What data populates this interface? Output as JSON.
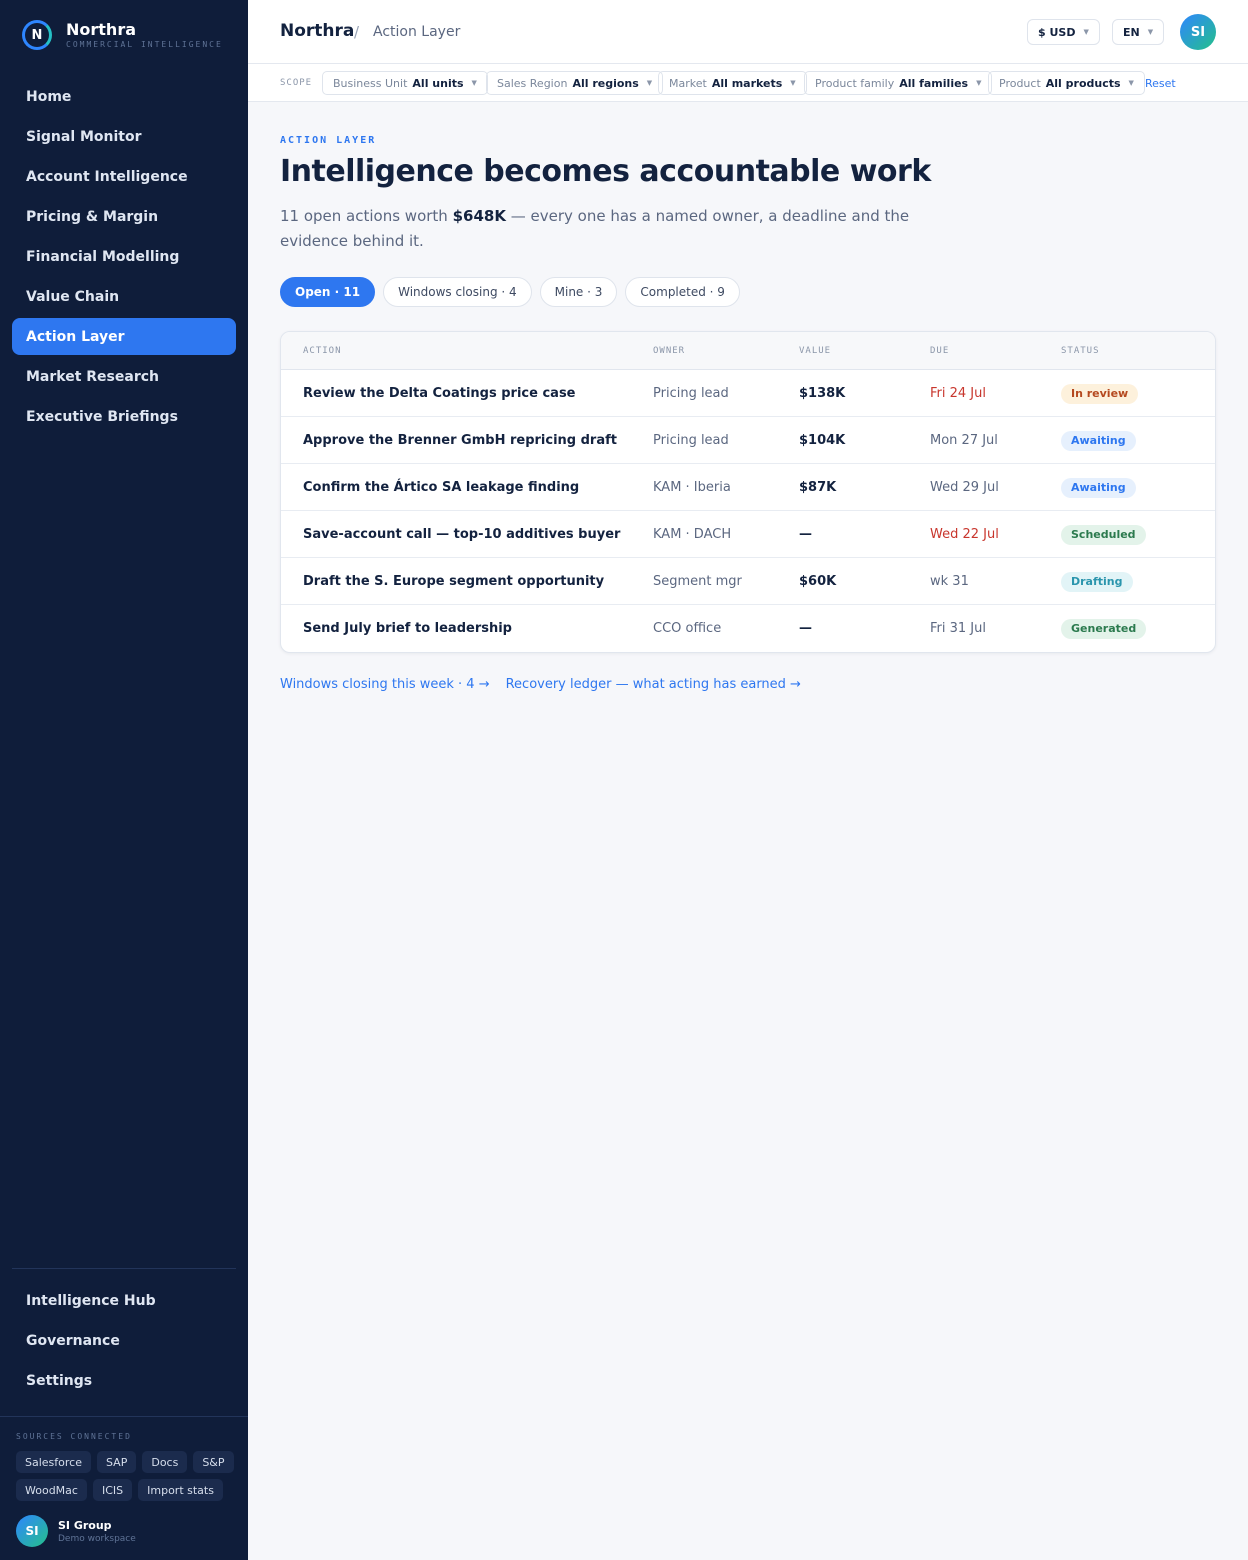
{
  "brand": {
    "name": "Northra",
    "tagline": "COMMERCIAL INTELLIGENCE",
    "logo_letter": "N"
  },
  "nav": [
    {
      "label": "Home"
    },
    {
      "label": "Signal Monitor"
    },
    {
      "label": "Account Intelligence"
    },
    {
      "label": "Pricing & Margin"
    },
    {
      "label": "Financial Modelling"
    },
    {
      "label": "Value Chain"
    },
    {
      "label": "Action Layer",
      "active": true
    },
    {
      "label": "Market Research"
    },
    {
      "label": "Executive Briefings"
    }
  ],
  "nav_bottom": [
    {
      "label": "Intelligence Hub"
    },
    {
      "label": "Governance"
    },
    {
      "label": "Settings"
    }
  ],
  "sources": {
    "label": "SOURCES CONNECTED",
    "items": [
      "Salesforce",
      "SAP",
      "Docs",
      "S&P",
      "WoodMac",
      "ICIS",
      "Import stats"
    ]
  },
  "workspace": {
    "initials": "SI",
    "name": "SI Group",
    "subtitle": "Demo workspace"
  },
  "topbar": {
    "app": "Northra",
    "separator": "/",
    "page": "Action Layer",
    "currency": "$ USD",
    "language": "EN",
    "user_initials": "SI"
  },
  "scope": {
    "label": "SCOPE",
    "filters": [
      {
        "label": "Business Unit",
        "value": "All units"
      },
      {
        "label": "Sales Region",
        "value": "All regions"
      },
      {
        "label": "Market",
        "value": "All markets"
      },
      {
        "label": "Product family",
        "value": "All families"
      },
      {
        "label": "Product",
        "value": "All products"
      }
    ],
    "reset": "Reset"
  },
  "main": {
    "eyebrow": "ACTION LAYER",
    "title": "Intelligence becomes accountable work",
    "lede_prefix": "11 open actions worth ",
    "lede_amount": "$648K",
    "lede_suffix": " — every one has a named owner, a deadline and the evidence behind it.",
    "tabs": [
      {
        "label": "Open · 11",
        "active": true
      },
      {
        "label": "Windows closing · 4"
      },
      {
        "label": "Mine · 3"
      },
      {
        "label": "Completed · 9"
      }
    ]
  },
  "table": {
    "columns": [
      "ACTION",
      "OWNER",
      "VALUE",
      "DUE",
      "STATUS"
    ],
    "rows": [
      {
        "action": "Review the Delta Coatings price case",
        "owner": "Pricing lead",
        "value": "$138K",
        "due": "Fri 24 Jul",
        "due_urgent": true,
        "status": "In review",
        "status_kind": "review"
      },
      {
        "action": "Approve the Brenner GmbH repricing draft",
        "owner": "Pricing lead",
        "value": "$104K",
        "due": "Mon 27 Jul",
        "due_urgent": false,
        "status": "Awaiting",
        "status_kind": "awaiting"
      },
      {
        "action": "Confirm the Ártico SA leakage finding",
        "owner": "KAM · Iberia",
        "value": "$87K",
        "due": "Wed 29 Jul",
        "due_urgent": false,
        "status": "Awaiting",
        "status_kind": "awaiting"
      },
      {
        "action": "Save-account call — top-10 additives buyer",
        "owner": "KAM · DACH",
        "value": "—",
        "due": "Wed 22 Jul",
        "due_urgent": true,
        "status": "Scheduled",
        "status_kind": "scheduled"
      },
      {
        "action": "Draft the S. Europe segment opportunity",
        "owner": "Segment mgr",
        "value": "$60K",
        "due": "wk 31",
        "due_urgent": false,
        "status": "Drafting",
        "status_kind": "drafting"
      },
      {
        "action": "Send July brief to leadership",
        "owner": "CCO office",
        "value": "—",
        "due": "Fri 31 Jul",
        "due_urgent": false,
        "status": "Generated",
        "status_kind": "generated"
      }
    ]
  },
  "footer_links": [
    {
      "label": "Windows closing this week · 4 →"
    },
    {
      "label": "Recovery ledger — what acting has earned →"
    }
  ],
  "colors": {
    "sidebar_bg": "#0f1d3a",
    "accent": "#2e77f0",
    "urgent": "#c8362d"
  }
}
